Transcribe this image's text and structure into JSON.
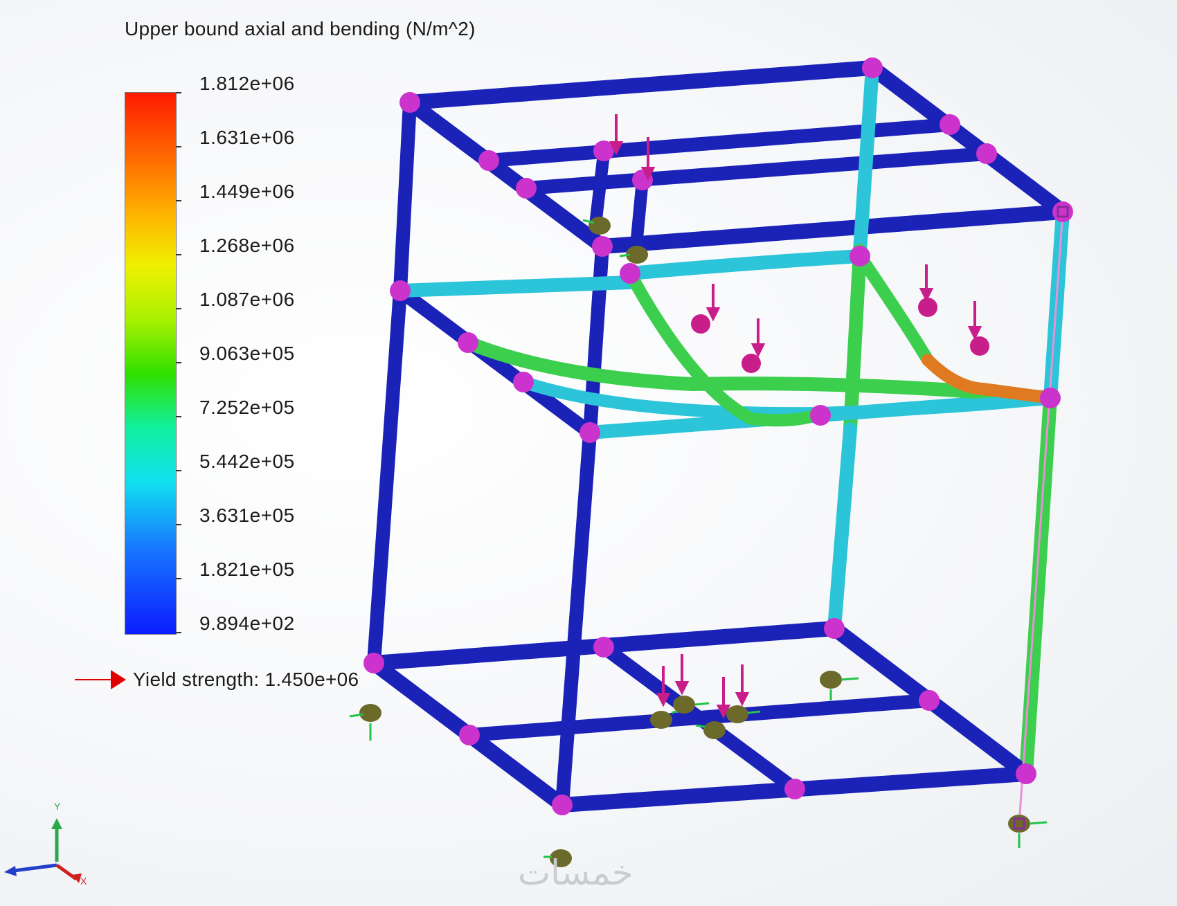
{
  "legend": {
    "title": "Upper bound axial and bending (N/m^2)",
    "tick_labels": [
      "1.812e+06",
      "1.631e+06",
      "1.449e+06",
      "1.268e+06",
      "1.087e+06",
      "9.063e+05",
      "7.252e+05",
      "5.442e+05",
      "3.631e+05",
      "1.821e+05",
      "9.894e+02"
    ],
    "colormap": [
      "#ff1a00",
      "#ff6a00",
      "#ffb000",
      "#f0f000",
      "#a8f000",
      "#30e000",
      "#10f0a0",
      "#10e0f0",
      "#1878ff",
      "#0b1cff"
    ]
  },
  "yield": {
    "label": "Yield strength: 1.450e+06",
    "arrow_color": "#e00000"
  },
  "triad": {
    "y_label": "Y",
    "x_label": "X"
  },
  "watermark": "خمسات",
  "colors": {
    "low_stress": "#1a22b8",
    "medium_stress": "#2cc4d8",
    "mid_high_stress": "#3ccf4e",
    "high_stress": "#e07a20",
    "joint": "#cc33cc",
    "load_arrow": "#c81e8a",
    "fixture": "#6b6a2a",
    "fixture_arrow": "#22c44a"
  }
}
